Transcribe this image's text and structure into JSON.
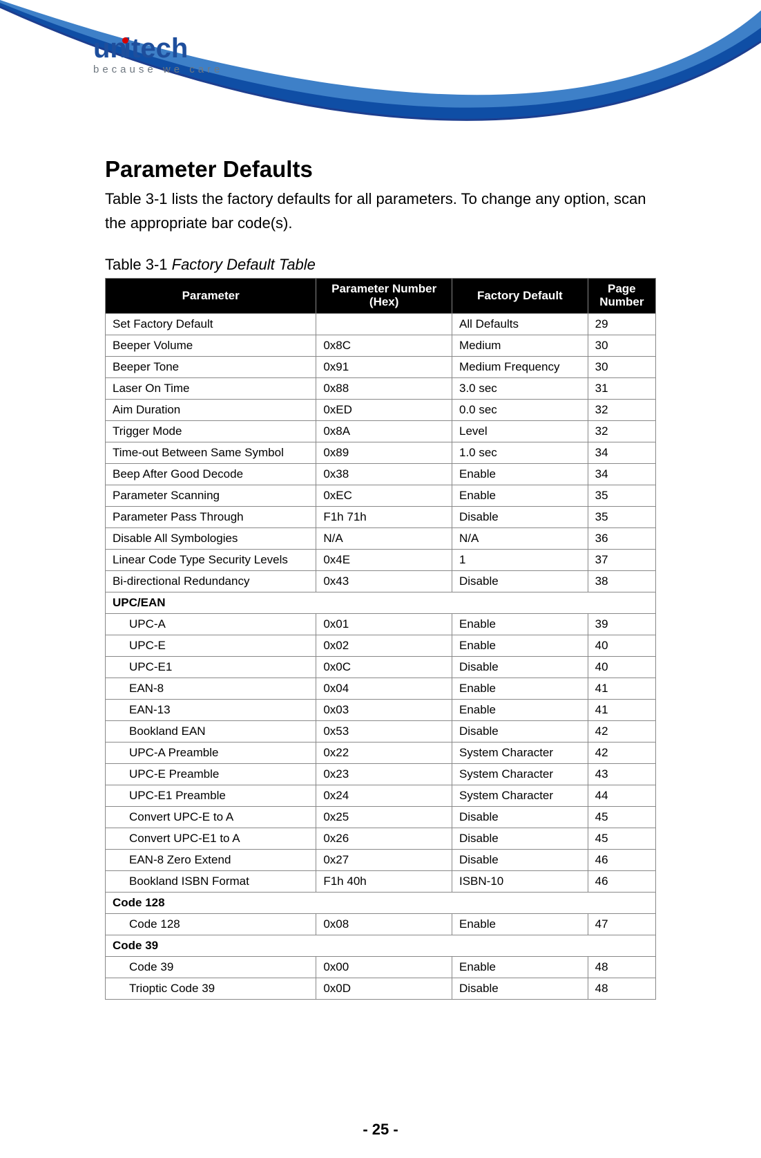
{
  "brand": {
    "name_prefix": "un",
    "name_mid": "i",
    "name_suffix": "tech",
    "tagline": "because  we  care"
  },
  "title": "Parameter Defaults",
  "intro": "Table 3-1 lists the factory defaults for all parameters. To change any option, scan the appropriate bar code(s).",
  "caption_prefix": "Table 3-1 ",
  "caption_italic": "Factory Default Table",
  "columns": {
    "c1": "Parameter",
    "c2": "Parameter Number (Hex)",
    "c3": "Factory Default",
    "c4": "Page Number"
  },
  "rows": [
    {
      "type": "row",
      "param": "Set Factory Default",
      "hex": "",
      "def": "All Defaults",
      "page": "29"
    },
    {
      "type": "row",
      "param": "Beeper Volume",
      "hex": "0x8C",
      "def": "Medium",
      "page": "30"
    },
    {
      "type": "row",
      "param": "Beeper Tone",
      "hex": "0x91",
      "def": "Medium Frequency",
      "page": "30"
    },
    {
      "type": "row",
      "param": "Laser On Time",
      "hex": "0x88",
      "def": "3.0 sec",
      "page": "31"
    },
    {
      "type": "row",
      "param": "Aim Duration",
      "hex": "0xED",
      "def": "0.0 sec",
      "page": "32"
    },
    {
      "type": "row",
      "param": "Trigger Mode",
      "hex": "0x8A",
      "def": "Level",
      "page": "32"
    },
    {
      "type": "row",
      "param": "Time-out Between Same Symbol",
      "hex": "0x89",
      "def": "1.0 sec",
      "page": "34"
    },
    {
      "type": "row",
      "param": "Beep After Good Decode",
      "hex": "0x38",
      "def": "Enable",
      "page": "34"
    },
    {
      "type": "row",
      "param": "Parameter Scanning",
      "hex": "0xEC",
      "def": "Enable",
      "page": "35"
    },
    {
      "type": "row",
      "param": "Parameter Pass Through",
      "hex": "F1h 71h",
      "def": "Disable",
      "page": "35"
    },
    {
      "type": "row",
      "param": "Disable All Symbologies",
      "hex": "N/A",
      "def": "N/A",
      "page": "36"
    },
    {
      "type": "row",
      "param": "Linear Code Type Security Levels",
      "hex": "0x4E",
      "def": "1",
      "page": "37"
    },
    {
      "type": "row",
      "param": "Bi-directional Redundancy",
      "hex": "0x43",
      "def": "Disable",
      "page": "38"
    },
    {
      "type": "section",
      "param": "UPC/EAN"
    },
    {
      "type": "sub",
      "param": "UPC-A",
      "hex": "0x01",
      "def": "Enable",
      "page": "39"
    },
    {
      "type": "sub",
      "param": "UPC-E",
      "hex": "0x02",
      "def": "Enable",
      "page": "40"
    },
    {
      "type": "sub",
      "param": "UPC-E1",
      "hex": "0x0C",
      "def": "Disable",
      "page": "40"
    },
    {
      "type": "sub",
      "param": "EAN-8",
      "hex": "0x04",
      "def": "Enable",
      "page": "41"
    },
    {
      "type": "sub",
      "param": "EAN-13",
      "hex": "0x03",
      "def": "Enable",
      "page": "41"
    },
    {
      "type": "sub",
      "param": "Bookland EAN",
      "hex": "0x53",
      "def": "Disable",
      "page": "42"
    },
    {
      "type": "sub",
      "param": "UPC-A Preamble",
      "hex": "0x22",
      "def": "System Character",
      "page": "42"
    },
    {
      "type": "sub",
      "param": "UPC-E Preamble",
      "hex": "0x23",
      "def": "System Character",
      "page": "43"
    },
    {
      "type": "sub",
      "param": "UPC-E1 Preamble",
      "hex": "0x24",
      "def": "System Character",
      "page": "44"
    },
    {
      "type": "sub",
      "param": "Convert UPC-E to A",
      "hex": "0x25",
      "def": "Disable",
      "page": "45"
    },
    {
      "type": "sub",
      "param": "Convert UPC-E1 to A",
      "hex": "0x26",
      "def": "Disable",
      "page": "45"
    },
    {
      "type": "sub",
      "param": "EAN-8 Zero Extend",
      "hex": "0x27",
      "def": "Disable",
      "page": "46"
    },
    {
      "type": "sub",
      "param": "Bookland ISBN Format",
      "hex": "F1h 40h",
      "def": "ISBN-10",
      "page": "46"
    },
    {
      "type": "section",
      "param": "Code 128"
    },
    {
      "type": "sub",
      "param": "Code 128",
      "hex": "0x08",
      "def": "Enable",
      "page": "47"
    },
    {
      "type": "section",
      "param": "Code 39"
    },
    {
      "type": "sub",
      "param": "Code 39",
      "hex": "0x00",
      "def": "Enable",
      "page": "48"
    },
    {
      "type": "sub",
      "param": "Trioptic Code 39",
      "hex": "0x0D",
      "def": "Disable",
      "page": "48"
    }
  ],
  "footer": "- 25 -"
}
